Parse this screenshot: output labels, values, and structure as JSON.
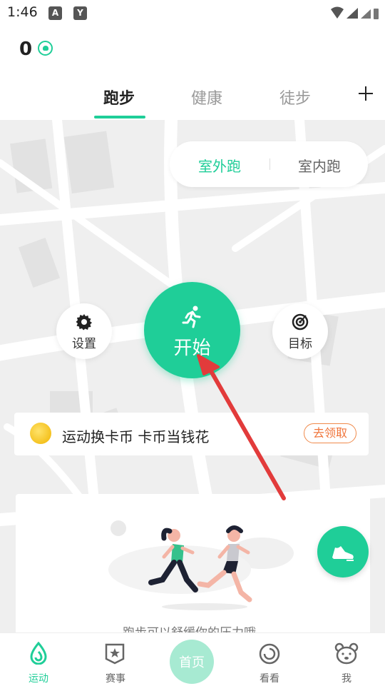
{
  "status_bar": {
    "time": "1:46",
    "notif_icons": [
      "A",
      "Y"
    ],
    "icons": [
      "wifi-icon",
      "signal-icon",
      "signal-icon",
      "battery-icon"
    ]
  },
  "header": {
    "coin_count": "0"
  },
  "tabs": [
    {
      "label": "跑步",
      "active": true
    },
    {
      "label": "健康",
      "active": false
    },
    {
      "label": "徒步",
      "active": false
    }
  ],
  "mode_switch": {
    "outdoor": "室外跑",
    "indoor": "室内跑",
    "selected": "室外跑"
  },
  "controls": {
    "settings_label": "设置",
    "start_label": "开始",
    "goal_label": "目标"
  },
  "promo": {
    "text": "运动换卡币 卡币当钱花",
    "claim_label": "去领取"
  },
  "card": {
    "caption": "跑步可以舒缓你的压力哦"
  },
  "bottom_nav": [
    {
      "label": "运动",
      "icon": "sport-drop-icon",
      "active": true
    },
    {
      "label": "赛事",
      "icon": "event-badge-icon",
      "active": false
    },
    {
      "label": "首页",
      "icon": "home-circle-icon",
      "active": false
    },
    {
      "label": "看看",
      "icon": "spiral-icon",
      "active": false
    },
    {
      "label": "我",
      "icon": "bear-face-icon",
      "active": false
    }
  ],
  "colors": {
    "accent": "#1fce98",
    "promo_orange": "#f0743a",
    "arrow_red": "#e23b3b"
  }
}
